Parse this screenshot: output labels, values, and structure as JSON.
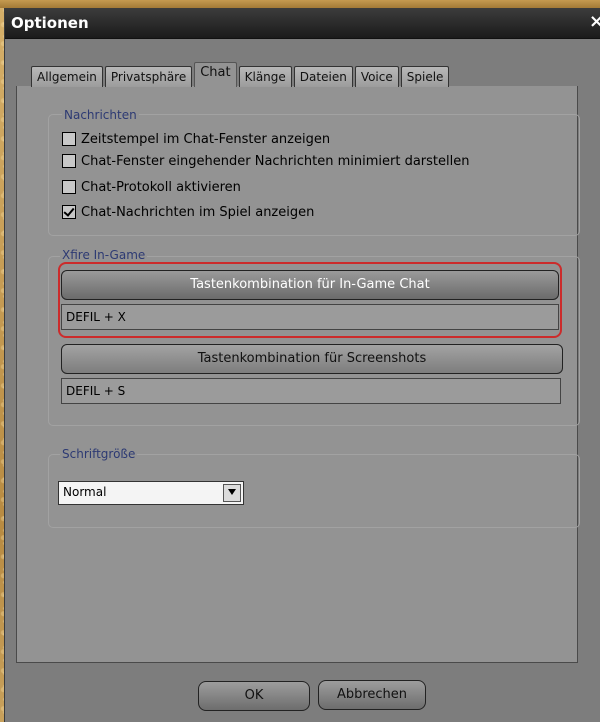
{
  "window": {
    "title": "Optionen"
  },
  "tabs": [
    {
      "label": "Allgemein",
      "active": false
    },
    {
      "label": "Privatsphäre",
      "active": false
    },
    {
      "label": "Chat",
      "active": true
    },
    {
      "label": "Klänge",
      "active": false
    },
    {
      "label": "Dateien",
      "active": false
    },
    {
      "label": "Voice",
      "active": false
    },
    {
      "label": "Spiele",
      "active": false
    }
  ],
  "messages_group": {
    "label": "Nachrichten",
    "options": [
      {
        "label": "Zeitstempel im Chat-Fenster anzeigen",
        "checked": false
      },
      {
        "label": "Chat-Fenster eingehender Nachrichten minimiert darstellen",
        "checked": false
      },
      {
        "label": "Chat-Protokoll aktivieren",
        "checked": false
      },
      {
        "label": "Chat-Nachrichten im Spiel anzeigen",
        "checked": true
      }
    ]
  },
  "ingame_group": {
    "label": "Xfire In-Game",
    "chat_hotkey": {
      "button_label": "Tastenkombination für In-Game Chat",
      "value": "DEFIL + X"
    },
    "screenshot_hotkey": {
      "button_label": "Tastenkombination für Screenshots",
      "value": "DEFIL + S"
    }
  },
  "font_group": {
    "label": "Schriftgröße",
    "selected": "Normal"
  },
  "buttons": {
    "ok": "OK",
    "cancel": "Abbrechen"
  },
  "colors": {
    "highlight": "#cc2b2b",
    "group_label": "#2d3a73"
  }
}
